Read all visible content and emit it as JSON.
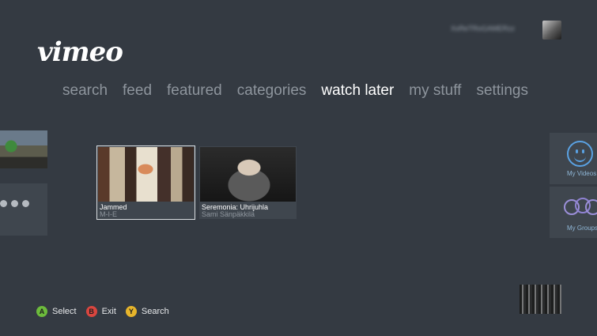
{
  "brand": {
    "logo_text": "vimeo"
  },
  "user": {
    "gamertag": "XxReTRoGAMERzz"
  },
  "nav": {
    "items": [
      {
        "label": "search"
      },
      {
        "label": "feed"
      },
      {
        "label": "featured"
      },
      {
        "label": "categories"
      },
      {
        "label": "watch later",
        "active": true
      },
      {
        "label": "my stuff"
      },
      {
        "label": "settings"
      }
    ]
  },
  "videos": [
    {
      "title": "Jammed",
      "author": "M-I-E",
      "selected": true
    },
    {
      "title": "Seremonia: Uhrijuhla",
      "author": "Sami Sänpäkkilä",
      "selected": false
    }
  ],
  "side_tiles": {
    "my_videos": "My Videos",
    "my_groups": "My Groups"
  },
  "footer": {
    "hints": [
      {
        "button": "A",
        "label": "Select",
        "color": "#6cbb3c"
      },
      {
        "button": "B",
        "label": "Exit",
        "color": "#d9463f"
      },
      {
        "button": "Y",
        "label": "Search",
        "color": "#e7b52b"
      }
    ]
  },
  "colors": {
    "background": "#343a42",
    "tile": "#3f464e",
    "accent_blue": "#5aa2e3",
    "accent_purple": "#9b8fd8"
  }
}
